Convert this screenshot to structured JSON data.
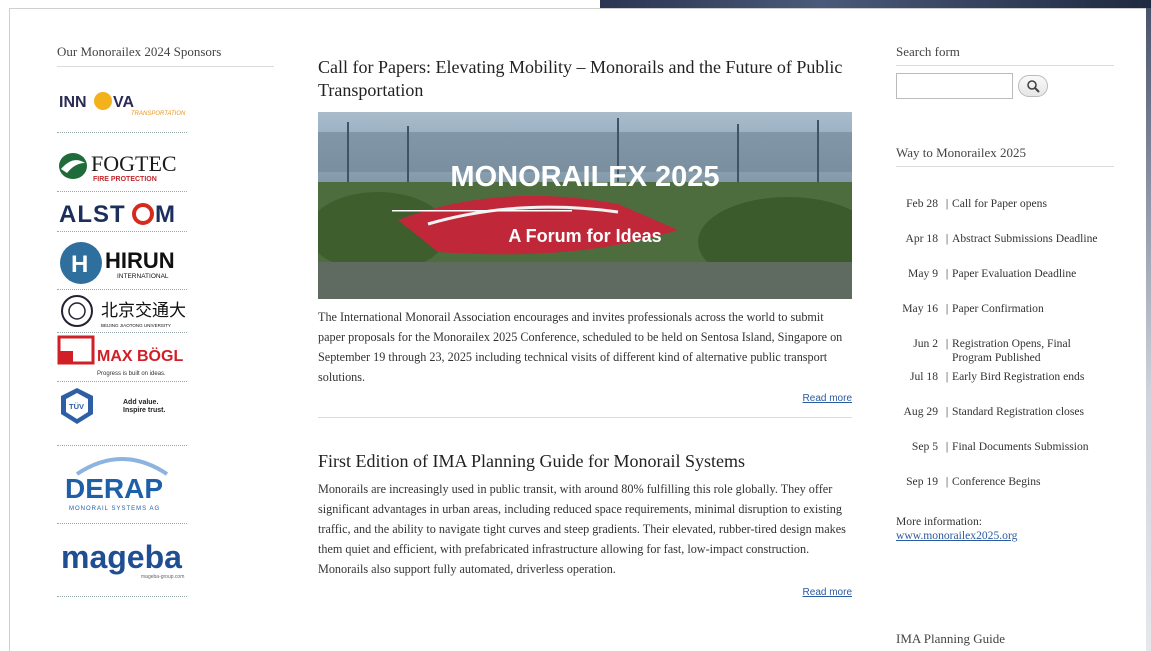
{
  "sponsors": {
    "heading": "Our Monorailex 2024 Sponsors",
    "logos": [
      {
        "name": "INNOVA",
        "sub": "TRANSPORTATION"
      },
      {
        "name": "FOGTEC",
        "sub": "FIRE PROTECTION"
      },
      {
        "name": "ALSTOM"
      },
      {
        "name": "HIRUN",
        "sub": "INTERNATIONAL"
      },
      {
        "name": "北京交通大學",
        "sub": "BEIJING JIAOTONG UNIVERSITY"
      },
      {
        "name": "MAX BÖGL",
        "sub": "Progress is built on ideas."
      },
      {
        "name": "TÜV SÜD",
        "sub": "Add value. Inspire trust."
      },
      {
        "name": "DERAP",
        "sub": "MONORAIL SYSTEMS AG"
      },
      {
        "name": "mageba",
        "sub": "mageba-group.com"
      }
    ]
  },
  "posts": [
    {
      "title": "Call for Papers: Elevating Mobility – Monorails and the Future of Public Transportation",
      "hero_title": "MONORAILEX 2025",
      "hero_subtitle": "A Forum for Ideas",
      "body": "The International Monorail Association encourages and invites professionals across the world to submit paper proposals for the Monorailex 2025 Conference, scheduled to be held on Sentosa Island, Singapore on September 19 through 23, 2025 including technical visits of different kind of alternative public transport solutions.",
      "read_more": "Read more"
    },
    {
      "title": "First Edition of IMA Planning Guide for Monorail Systems",
      "body": "Monorails are increasingly used in public transit, with around 80% fulfilling this role globally. They offer significant advantages in urban areas, including reduced space requirements, minimal disruption to existing traffic, and the ability to navigate tight curves and steep gradients. Their elevated, rubber-tired design makes them quiet and efficient, with prefabricated infrastructure allowing for fast, low-impact construction. Monorails also support fully automated, driverless operation.",
      "read_more": "Read more"
    }
  ],
  "search": {
    "heading": "Search form",
    "value": ""
  },
  "timeline": {
    "heading": "Way to Monorailex 2025",
    "items": [
      {
        "date": "Feb 28",
        "text": "Call for Paper opens"
      },
      {
        "date": "Apr 18",
        "text": "Abstract Submissions Deadline"
      },
      {
        "date": "May 9",
        "text": "Paper Evaluation Deadline"
      },
      {
        "date": "May 16",
        "text": "Paper Confirmation"
      },
      {
        "date": "Jun 2",
        "text": "Registration Opens, Final Program Published"
      },
      {
        "date": "Jul 18",
        "text": "Early Bird Registration ends"
      },
      {
        "date": "Aug 29",
        "text": "Standard Registration closes"
      },
      {
        "date": "Sep 5",
        "text": "Final Documents Submission"
      },
      {
        "date": "Sep 19",
        "text": "Conference Begins"
      }
    ],
    "separator": "|"
  },
  "more_info": {
    "label": "More information:",
    "link": "www.monorailex2025.org"
  },
  "planning_guide": {
    "heading": "IMA Planning Guide"
  }
}
